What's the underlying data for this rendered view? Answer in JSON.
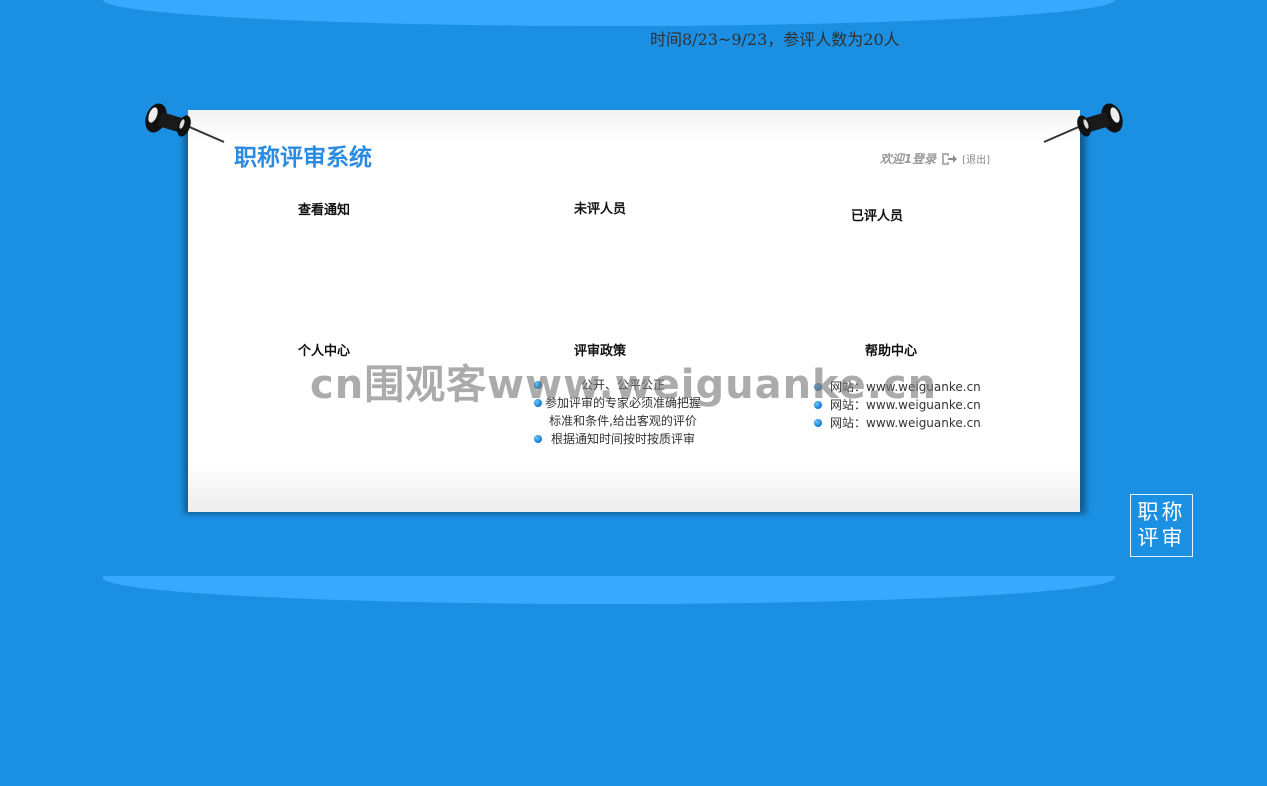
{
  "notice": "时间8/23~9/23，参评人数为20人",
  "header": {
    "title": "职称评审系统",
    "welcome": "欢迎1登录",
    "logout_label": "[退出]"
  },
  "sections": {
    "view_notice": "查看通知",
    "unreviewed": "未评人员",
    "reviewed": "已评人员",
    "personal_center": "个人中心",
    "review_policy": "评审政策",
    "help_center": "帮助中心"
  },
  "policy_items": [
    "公开、公平公正",
    "参加评审的专家必须准确把握",
    "标准和条件,给出客观的评价",
    "根据通知时间按时按质评审"
  ],
  "help_items": [
    "网站：www.weiguanke.cn",
    "网站：www.weiguanke.cn",
    "网站：www.weiguanke.cn"
  ],
  "watermark": "cn围观客www.weiguanke.cn",
  "side_badge": {
    "line1": "职称",
    "line2": "评审"
  },
  "colors": {
    "background": "#1b8fe2",
    "band": "#38a9ff",
    "title": "#2a8be0"
  }
}
